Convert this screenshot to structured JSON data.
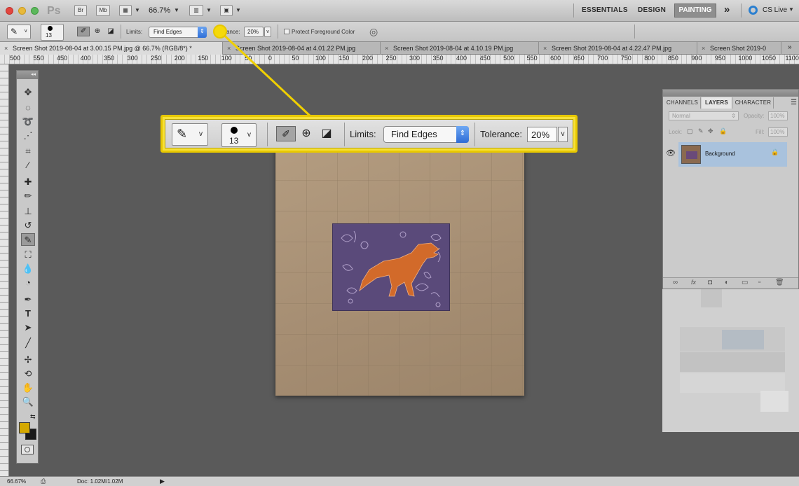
{
  "app": {
    "logo": "Ps",
    "bridge_btn": "Br",
    "minibridge_btn": "Mb",
    "zoom_level": "66.7%",
    "workspaces": [
      "ESSENTIALS",
      "DESIGN",
      "PAINTING"
    ],
    "active_workspace": "PAINTING",
    "cs_live": "CS Live",
    "more": "»"
  },
  "options_bar": {
    "brush_size": "13",
    "limits_label": "Limits:",
    "limits_value": "Find Edges",
    "tolerance_label": "ance:",
    "tolerance_value": "20%",
    "protect_label": "Protect Foreground Color"
  },
  "tabs": [
    {
      "label": "Screen Shot 2019-08-04 at 3.00.15 PM.jpg @ 66.7% (RGB/8*) *",
      "close": "×"
    },
    {
      "label": "Screen Shot 2019-08-04 at 4.01.22 PM.jpg",
      "close": "×"
    },
    {
      "label": "Screen Shot 2019-08-04 at 4.10.19 PM.jpg",
      "close": "×"
    },
    {
      "label": "Screen Shot 2019-08-04 at 4.22.47 PM.jpg",
      "close": "×"
    },
    {
      "label": "Screen Shot 2019-0",
      "close": "×"
    }
  ],
  "ruler_labels": [
    "500",
    "550",
    "450",
    "400",
    "350",
    "300",
    "250",
    "200",
    "150",
    "100",
    "50",
    "0",
    "50",
    "100",
    "150",
    "200",
    "250",
    "300",
    "350",
    "400",
    "450",
    "500",
    "550",
    "600",
    "650",
    "700",
    "750",
    "800",
    "850",
    "900",
    "950",
    "1000",
    "1050",
    "1100"
  ],
  "callout": {
    "brush_size": "13",
    "limits_label": "Limits:",
    "limits_value": "Find Edges",
    "tolerance_label": "Tolerance:",
    "tolerance_value": "20%",
    "dropdown_caret": "v"
  },
  "layers_panel": {
    "tabs": [
      "CHANNELS",
      "LAYERS",
      "CHARACTER"
    ],
    "blend_mode": "Normal",
    "opacity_label": "Opacity:",
    "opacity_value": "100%",
    "lock_label": "Lock:",
    "fill_label": "Fill:",
    "fill_value": "100%",
    "layer_name": "Background"
  },
  "status": {
    "zoom": "66.67%",
    "doc": "Doc: 1.02M/1.02M"
  },
  "colors": {
    "foreground": "#d4a800",
    "background": "#1a1a1a",
    "callout": "#f7e13a",
    "accent_blue": "#2f6fd8"
  }
}
